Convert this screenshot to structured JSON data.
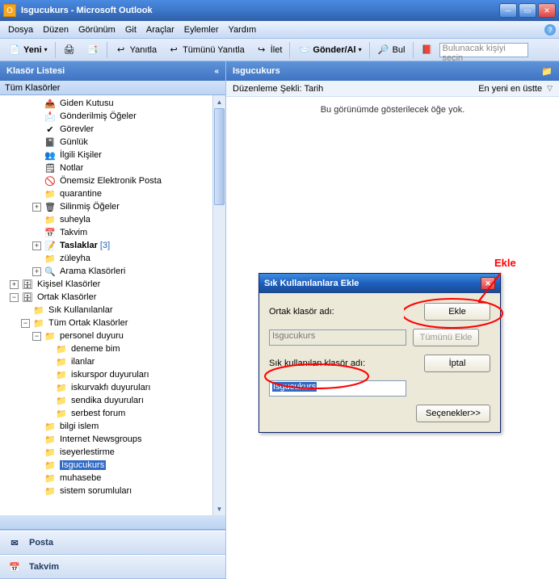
{
  "window": {
    "title": "Isgucukurs - Microsoft Outlook"
  },
  "menu": [
    "Dosya",
    "Düzen",
    "Görünüm",
    "Git",
    "Araçlar",
    "Eylemler",
    "Yardım"
  ],
  "toolbar": {
    "new": "Yeni",
    "reply": "Yanıtla",
    "reply_all": "Tümünü Yanıtla",
    "forward": "İlet",
    "send_recv": "Gönder/Al",
    "find": "Bul",
    "search_placeholder": "Bulunacak kişiyi seçin"
  },
  "left_panel": {
    "header": "Klasör Listesi",
    "sub": "Tüm Klasörler"
  },
  "tree": {
    "giden": "Giden Kutusu",
    "gonderilmis": "Gönderilmiş Öğeler",
    "gorevler": "Görevler",
    "gunluk": "Günlük",
    "ilgili": "İlgili Kişiler",
    "notlar": "Notlar",
    "onemsiz": "Önemsiz Elektronik Posta",
    "quarantine": "quarantine",
    "silinmis": "Silinmiş Öğeler",
    "suheyla": "suheyla",
    "takvim": "Takvim",
    "taslaklar": "Taslaklar",
    "taslaklar_count": "[3]",
    "zuleyha": "züleyha",
    "arama": "Arama Klasörleri",
    "kisisel": "Kişisel Klasörler",
    "ortak": "Ortak Klasörler",
    "sik": "Sık Kullanılanlar",
    "tum_ortak": "Tüm Ortak Klasörler",
    "personel": "personel duyuru",
    "deneme": "deneme bim",
    "ilanlar": "ilanlar",
    "iskurspor": "iskurspor duyuruları",
    "iskurvakfi": "iskurvakfı duyuruları",
    "sendika": "sendika duyuruları",
    "serbest": "serbest forum",
    "bilgi": "bilgi islem",
    "internet": "Internet Newsgroups",
    "iseyer": "iseyerlestirme",
    "isgucukurs": "Isgucukurs",
    "muhasebe": "muhasebe",
    "sistem": "sistem sorumluları"
  },
  "nav": {
    "posta": "Posta",
    "takvim": "Takvim"
  },
  "right_panel": {
    "header": "Isgucukurs",
    "sort_left": "Düzenleme Şekli: Tarih",
    "sort_right": "En yeni en üstte",
    "empty": "Bu görünümde gösterilecek öğe yok."
  },
  "dialog": {
    "title": "Sık Kullanılanlara Ekle",
    "label1": "Ortak klasör adı:",
    "input1": "Isgucukurs",
    "label2": "Sık kullanılan klasör adı:",
    "input2": "Isgucukurs",
    "btn_add": "Ekle",
    "btn_all": "Tümünü Ekle",
    "btn_cancel": "İptal",
    "btn_opts": "Seçenekler>>"
  },
  "annotation": {
    "ekle": "Ekle"
  }
}
